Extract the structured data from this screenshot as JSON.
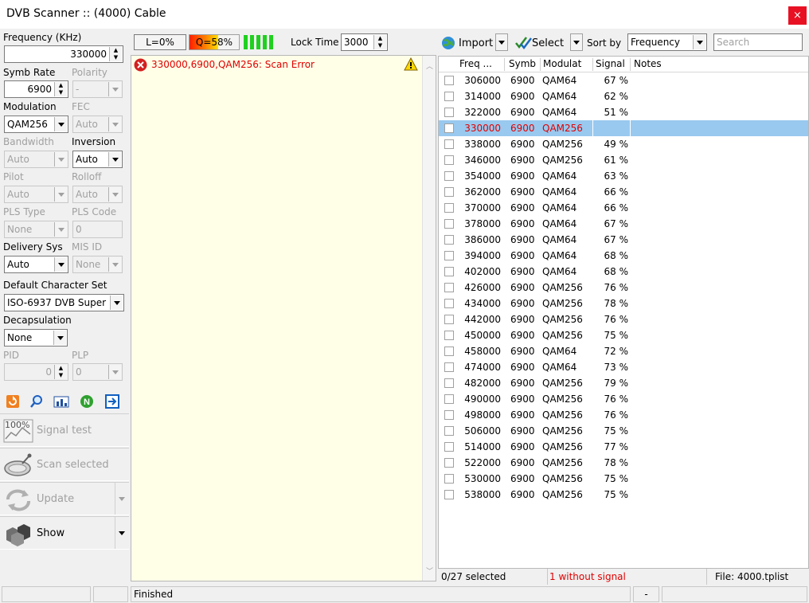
{
  "window": {
    "title": "DVB Scanner :: (4000) Cable",
    "close_glyph": "×"
  },
  "left": {
    "frequency_label": "Frequency (KHz)",
    "frequency_value": "330000",
    "symb_rate_label": "Symb Rate",
    "symb_rate_value": "6900",
    "polarity_label": "Polarity",
    "polarity_value": "-",
    "modulation_label": "Modulation",
    "modulation_value": "QAM256",
    "fec_label": "FEC",
    "fec_value": "Auto",
    "bandwidth_label": "Bandwidth",
    "bandwidth_value": "Auto",
    "inversion_label": "Inversion",
    "inversion_value": "Auto",
    "pilot_label": "Pilot",
    "pilot_value": "Auto",
    "rolloff_label": "Rolloff",
    "rolloff_value": "Auto",
    "pls_type_label": "PLS Type",
    "pls_type_value": "None",
    "pls_code_label": "PLS Code",
    "pls_code_value": "0",
    "delivery_sys_label": "Delivery Sys",
    "delivery_sys_value": "Auto",
    "mis_id_label": "MIS ID",
    "mis_id_value": "None",
    "charset_label": "Default Character Set",
    "charset_value": "ISO-6937 DVB Super",
    "decap_label": "Decapsulation",
    "decap_value": "None",
    "pid_label": "PID",
    "pid_value": "0",
    "plp_label": "PLP",
    "plp_value": "0",
    "signal_test_label": "Signal test",
    "signal_test_icon_text": "100%",
    "scan_selected_label": "Scan selected",
    "update_label": "Update",
    "show_label": "Show"
  },
  "meter": {
    "level_label": "L=0%",
    "quality_label": "Q=58%",
    "quality_fraction": 0.58,
    "lock_time_label": "Lock Time",
    "lock_time_value": "3000"
  },
  "log": {
    "lines": [
      "330000,6900,QAM256: Scan Error"
    ]
  },
  "toolbar": {
    "import_label": "Import",
    "select_label": "Select",
    "sort_by_label": "Sort by",
    "sort_by_value": "Frequency",
    "search_placeholder": "Search"
  },
  "list": {
    "columns": [
      "Freq ...",
      "Symb",
      "Modulat",
      "Signal",
      "Notes"
    ],
    "rows": [
      {
        "freq": "306000",
        "symb": "6900",
        "mod": "QAM64",
        "signal": "67 %"
      },
      {
        "freq": "314000",
        "symb": "6900",
        "mod": "QAM64",
        "signal": "62 %"
      },
      {
        "freq": "322000",
        "symb": "6900",
        "mod": "QAM64",
        "signal": "51 %"
      },
      {
        "freq": "330000",
        "symb": "6900",
        "mod": "QAM256",
        "signal": "",
        "selected": true
      },
      {
        "freq": "338000",
        "symb": "6900",
        "mod": "QAM256",
        "signal": "49 %"
      },
      {
        "freq": "346000",
        "symb": "6900",
        "mod": "QAM256",
        "signal": "61 %"
      },
      {
        "freq": "354000",
        "symb": "6900",
        "mod": "QAM64",
        "signal": "63 %"
      },
      {
        "freq": "362000",
        "symb": "6900",
        "mod": "QAM64",
        "signal": "66 %"
      },
      {
        "freq": "370000",
        "symb": "6900",
        "mod": "QAM64",
        "signal": "66 %"
      },
      {
        "freq": "378000",
        "symb": "6900",
        "mod": "QAM64",
        "signal": "67 %"
      },
      {
        "freq": "386000",
        "symb": "6900",
        "mod": "QAM64",
        "signal": "67 %"
      },
      {
        "freq": "394000",
        "symb": "6900",
        "mod": "QAM64",
        "signal": "68 %"
      },
      {
        "freq": "402000",
        "symb": "6900",
        "mod": "QAM64",
        "signal": "68 %"
      },
      {
        "freq": "426000",
        "symb": "6900",
        "mod": "QAM256",
        "signal": "76 %"
      },
      {
        "freq": "434000",
        "symb": "6900",
        "mod": "QAM256",
        "signal": "78 %"
      },
      {
        "freq": "442000",
        "symb": "6900",
        "mod": "QAM256",
        "signal": "76 %"
      },
      {
        "freq": "450000",
        "symb": "6900",
        "mod": "QAM256",
        "signal": "75 %"
      },
      {
        "freq": "458000",
        "symb": "6900",
        "mod": "QAM64",
        "signal": "72 %"
      },
      {
        "freq": "474000",
        "symb": "6900",
        "mod": "QAM64",
        "signal": "73 %"
      },
      {
        "freq": "482000",
        "symb": "6900",
        "mod": "QAM256",
        "signal": "79 %"
      },
      {
        "freq": "490000",
        "symb": "6900",
        "mod": "QAM256",
        "signal": "76 %"
      },
      {
        "freq": "498000",
        "symb": "6900",
        "mod": "QAM256",
        "signal": "76 %"
      },
      {
        "freq": "506000",
        "symb": "6900",
        "mod": "QAM256",
        "signal": "75 %"
      },
      {
        "freq": "514000",
        "symb": "6900",
        "mod": "QAM256",
        "signal": "77 %"
      },
      {
        "freq": "522000",
        "symb": "6900",
        "mod": "QAM256",
        "signal": "78 %"
      },
      {
        "freq": "530000",
        "symb": "6900",
        "mod": "QAM256",
        "signal": "75 %"
      },
      {
        "freq": "538000",
        "symb": "6900",
        "mod": "QAM256",
        "signal": "75 %"
      }
    ]
  },
  "list_status": {
    "selected_count": "0/27 selected",
    "without_signal": "1 without signal",
    "file": "File: 4000.tplist"
  },
  "status": {
    "message": "Finished",
    "dash": "-"
  },
  "colors": {
    "error_red": "#e00000",
    "selection_blue": "#99c9ef",
    "log_background": "#ffffe8",
    "close_red": "#e81123"
  }
}
